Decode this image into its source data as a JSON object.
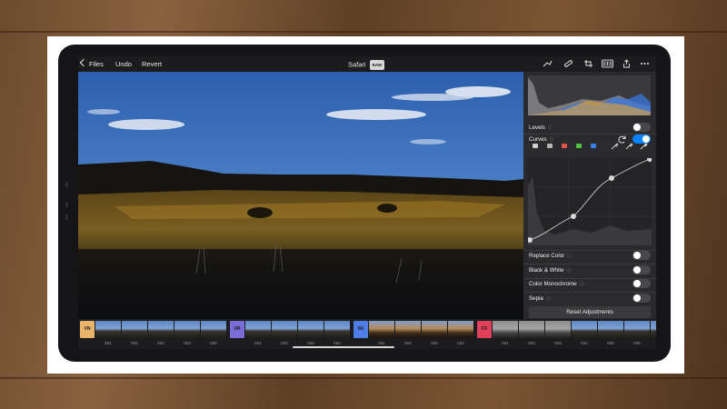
{
  "topbar": {
    "files_label": "Files",
    "undo_label": "Undo",
    "revert_label": "Revert",
    "title": "Safari",
    "raw_badge": "RAW",
    "icons": [
      "brush-icon",
      "bandage-icon",
      "crop-icon",
      "adjustments-icon",
      "share-icon",
      "more-icon"
    ]
  },
  "panel": {
    "levels": {
      "label": "Levels",
      "enabled": false
    },
    "curves": {
      "label": "Curves",
      "enabled": true
    },
    "curve_channels": [
      "#d0d0d0",
      "#b5b5b5",
      "#e5534b",
      "#52c44a",
      "#3a7ee8"
    ],
    "adjustments": [
      {
        "label": "Replace Color",
        "enabled": false
      },
      {
        "label": "Black & White",
        "enabled": false
      },
      {
        "label": "Color Monochrome",
        "enabled": false
      },
      {
        "label": "Sepia",
        "enabled": false
      }
    ],
    "reset_label": "Reset Adjustments"
  },
  "filmstrip": {
    "groups": [
      {
        "badge": "VN",
        "color": "#e8b56b",
        "tone": "cool",
        "labels": [
          "001",
          "002",
          "003",
          "004",
          "005"
        ]
      },
      {
        "badge": "UR",
        "color": "#7a6cd9",
        "tone": "cool",
        "labels": [
          "001",
          "002",
          "003",
          "004"
        ]
      },
      {
        "badge": "NX",
        "color": "#4f7fe6",
        "tone": "warm",
        "labels": [
          "001",
          "002",
          "003",
          "004"
        ]
      },
      {
        "badge": "FX",
        "color": "#e0405a",
        "tone": "mixed",
        "labels": [
          "001",
          "002",
          "003",
          "004",
          "005",
          "006",
          "007"
        ]
      }
    ]
  }
}
